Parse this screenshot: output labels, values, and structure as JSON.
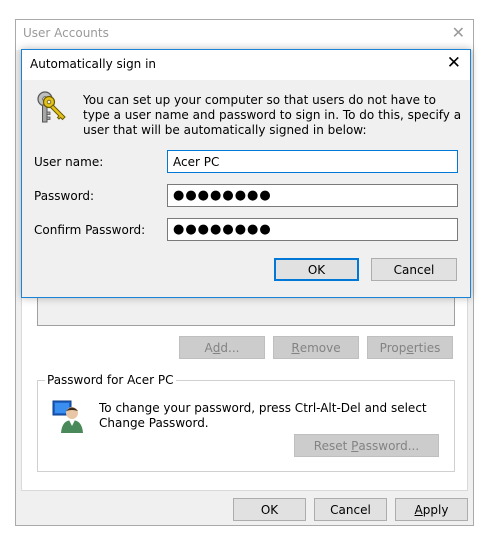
{
  "outer_window": {
    "title": "User Accounts",
    "close_glyph": "✕",
    "buttons": {
      "add_prefix": "A",
      "add_underlined": "d",
      "add_suffix": "d...",
      "remove_underlined": "R",
      "remove_suffix": "emove",
      "properties_prefix": "Prop",
      "properties_underlined": "e",
      "properties_suffix": "rties"
    },
    "password_group": {
      "label": "Password for Acer PC",
      "text": "To change your password, press Ctrl-Alt-Del and select Change Password.",
      "reset_prefix": "Reset ",
      "reset_underlined": "P",
      "reset_suffix": "assword..."
    },
    "footer": {
      "ok": "OK",
      "cancel": "Cancel",
      "apply_underlined": "A",
      "apply_suffix": "pply"
    }
  },
  "dialog": {
    "title": "Automatically sign in",
    "close_glyph": "✕",
    "description": "You can set up your computer so that users do not have to type a user name and password to sign in. To do this, specify a user that will be automatically signed in below:",
    "fields": {
      "username_label": "User name:",
      "username_value": "Acer PC",
      "password_label": "Password:",
      "password_value": "●●●●●●●●",
      "confirm_label": "Confirm Password:",
      "confirm_value": "●●●●●●●●"
    },
    "ok": "OK",
    "cancel": "Cancel"
  },
  "icons": {
    "dialog_icon": "keys-icon",
    "password_icon": "user-password-icon"
  },
  "colors": {
    "accent": "#0078d7",
    "dialog_border": "#1883d7",
    "window_bg": "#f0f0f0",
    "disabled_text": "#838383"
  }
}
